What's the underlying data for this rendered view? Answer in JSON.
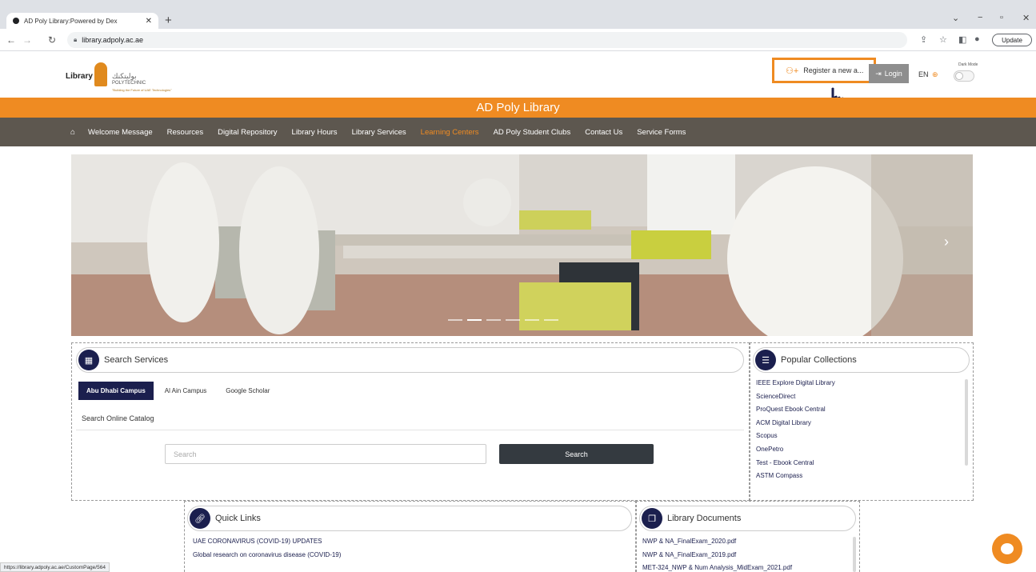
{
  "browser": {
    "tab_title": "AD Poly Library:Powered by Dex",
    "url": "library.adpoly.ac.ae",
    "update_label": "Update",
    "status_url": "https://library.adpoly.ac.ae/CustomPage/564"
  },
  "header": {
    "logo_library": "Library",
    "logo_arabic": "بوليتكنك",
    "logo_poly": "POLYTECHNIC",
    "logo_tagline": "\"Building the Future of UAE Technologies\"",
    "register_label": "Register a new a...",
    "login_label": "Login",
    "language": "EN",
    "dark_mode_label": "Dark Mode"
  },
  "site_title": "AD Poly Library",
  "nav": {
    "items": [
      {
        "label": "Welcome Message"
      },
      {
        "label": "Resources"
      },
      {
        "label": "Digital Repository"
      },
      {
        "label": "Library Hours"
      },
      {
        "label": "Library Services"
      },
      {
        "label": "Learning Centers"
      },
      {
        "label": "AD Poly Student Clubs"
      },
      {
        "label": "Contact Us"
      },
      {
        "label": "Service Forms"
      }
    ],
    "active_item": "Learning Centers"
  },
  "search_services": {
    "title": "Search Services",
    "tabs": [
      "Abu Dhabi Campus",
      "Al Ain Campus",
      "Google Scholar"
    ],
    "active_tab": "Abu Dhabi Campus",
    "catalog_label": "Search Online Catalog",
    "search_placeholder": "Search",
    "search_button": "Search"
  },
  "popular_collections": {
    "title": "Popular Collections",
    "items": [
      "IEEE Explore Digital Library",
      "ScienceDirect",
      "ProQuest Ebook Central",
      "ACM Digital Library",
      "Scopus",
      "OnePetro",
      "Test - Ebook Central",
      "ASTM Compass"
    ]
  },
  "quick_links": {
    "title": "Quick Links",
    "items": [
      "UAE CORONAVIRUS (COVID-19) UPDATES",
      "Global research on coronavirus disease (COVID-19)"
    ]
  },
  "library_documents": {
    "title": "Library Documents",
    "items": [
      "NWP & NA_FinalExam_2020.pdf",
      "NWP & NA_FinalExam_2019.pdf",
      "MET-324_NWP & Num Analysis_MidExam_2021.pdf"
    ]
  },
  "colors": {
    "brand_orange": "#ef8b22",
    "nav_bg": "#5d574f",
    "navy": "#1b1f4e"
  }
}
